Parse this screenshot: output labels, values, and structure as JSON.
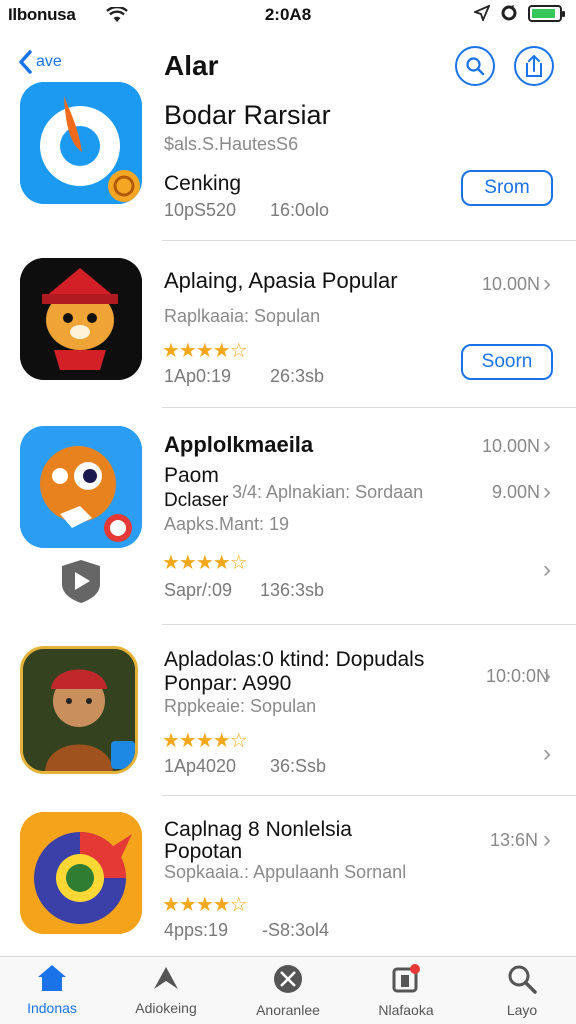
{
  "status_bar": {
    "carrier": "Ilbonusa",
    "time": "2:0A8",
    "battery_level": 0.9
  },
  "header": {
    "back_label": "ave",
    "title": "Alar",
    "accent_color": "#1a73e8"
  },
  "apps": [
    {
      "name": "Bodar Rarsiar",
      "subtitle": "$als.S.HautesS6",
      "category": "Cenking",
      "stat1": "10pS520",
      "stat2": "16:0olo",
      "button": "Srom"
    },
    {
      "name": "Aplaing, Apasia Popular",
      "subtitle": "Raplkaaia: Sopulan",
      "price": "10.00N",
      "rating": 4.5,
      "stat1": "1Ap0:19",
      "stat2": "26:3sb",
      "button": "Soorn"
    },
    {
      "name": "Applolkmaeila",
      "line2": "Paom",
      "line3a": "Dclaser",
      "line3b": "3/4: Aplnakian: Sordaan",
      "line4": "Aapks.Mant: 19",
      "price": "10.00N",
      "price2": "9.00N",
      "rating": 4.5,
      "stat1": "Sapr/:09",
      "stat2": "136:3sb"
    },
    {
      "name": "Apladolas:0 ktind: Dopudals",
      "line2": "Ponpar: A990",
      "subtitle": "Rppkeaie: Sopulan",
      "price": "10:0:0N",
      "rating": 4.5,
      "stat1": "1Ap4020",
      "stat2": "36:Ssb"
    },
    {
      "name": "Caplnag 8 Nonlelsia",
      "line2": "Popotan",
      "subtitle": "Sopkaaia.: Appulaanh Sornanl",
      "price": "13:6N",
      "rating": 4.5,
      "stat1": "4pps:19",
      "stat2": "-S8:3ol4"
    }
  ],
  "tabs": [
    {
      "label": "Indonas",
      "icon": "home-icon",
      "active": true
    },
    {
      "label": "Adiokeing",
      "icon": "rocket-icon",
      "active": false
    },
    {
      "label": "Anoranlee",
      "icon": "games-icon",
      "active": false
    },
    {
      "label": "Nlafaoka",
      "icon": "apps-icon",
      "active": false
    },
    {
      "label": "Layo",
      "icon": "search-icon",
      "active": false
    }
  ]
}
